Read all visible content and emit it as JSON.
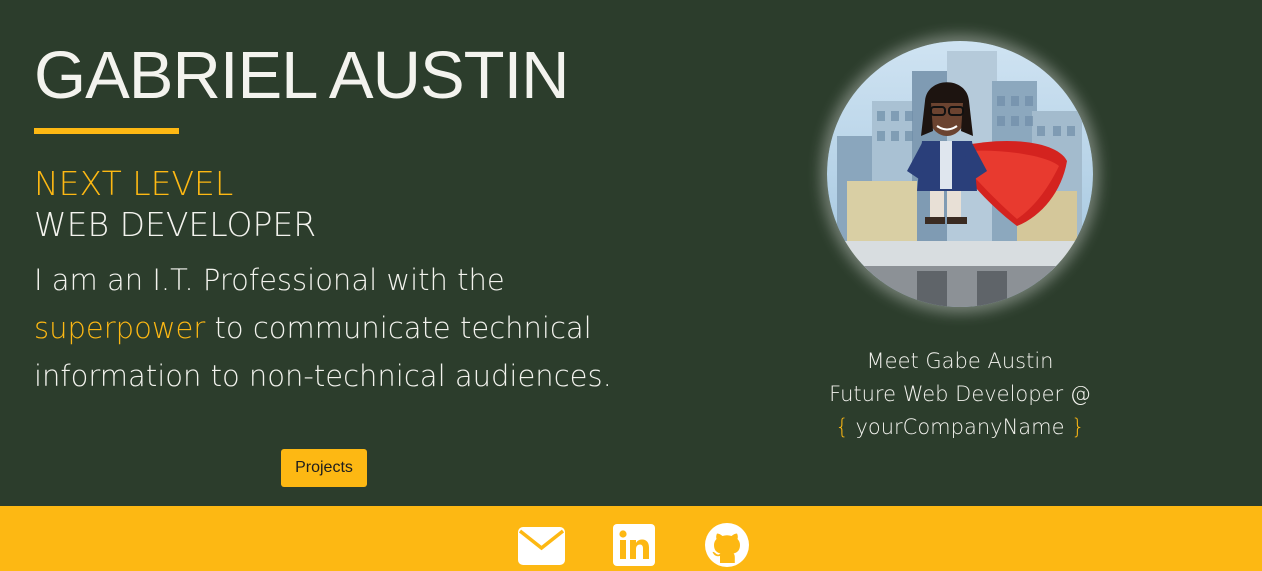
{
  "hero": {
    "name": "GABRIEL AUSTIN",
    "tagline_highlight": "NEXT LEVEL",
    "tagline_rest": "WEB DEVELOPER",
    "bio_part1": "I am an I.T. Professional with the ",
    "bio_highlight": "superpower",
    "bio_part2": " to communicate technical information to non-technical audiences.",
    "projects_button": "Projects"
  },
  "profile": {
    "avatar_alt": "Gabe Austin superhero avatar",
    "caption_line1": "Meet Gabe Austin",
    "caption_line2": "Future Web Developer @",
    "brace_open": "{",
    "company_placeholder": " yourCompanyName ",
    "brace_close": "}"
  },
  "footer": {
    "icons": [
      "envelope-icon",
      "linkedin-icon",
      "github-icon"
    ]
  },
  "colors": {
    "background": "#2c3d2c",
    "accent": "#fdb813",
    "text": "#f3f3ee"
  }
}
